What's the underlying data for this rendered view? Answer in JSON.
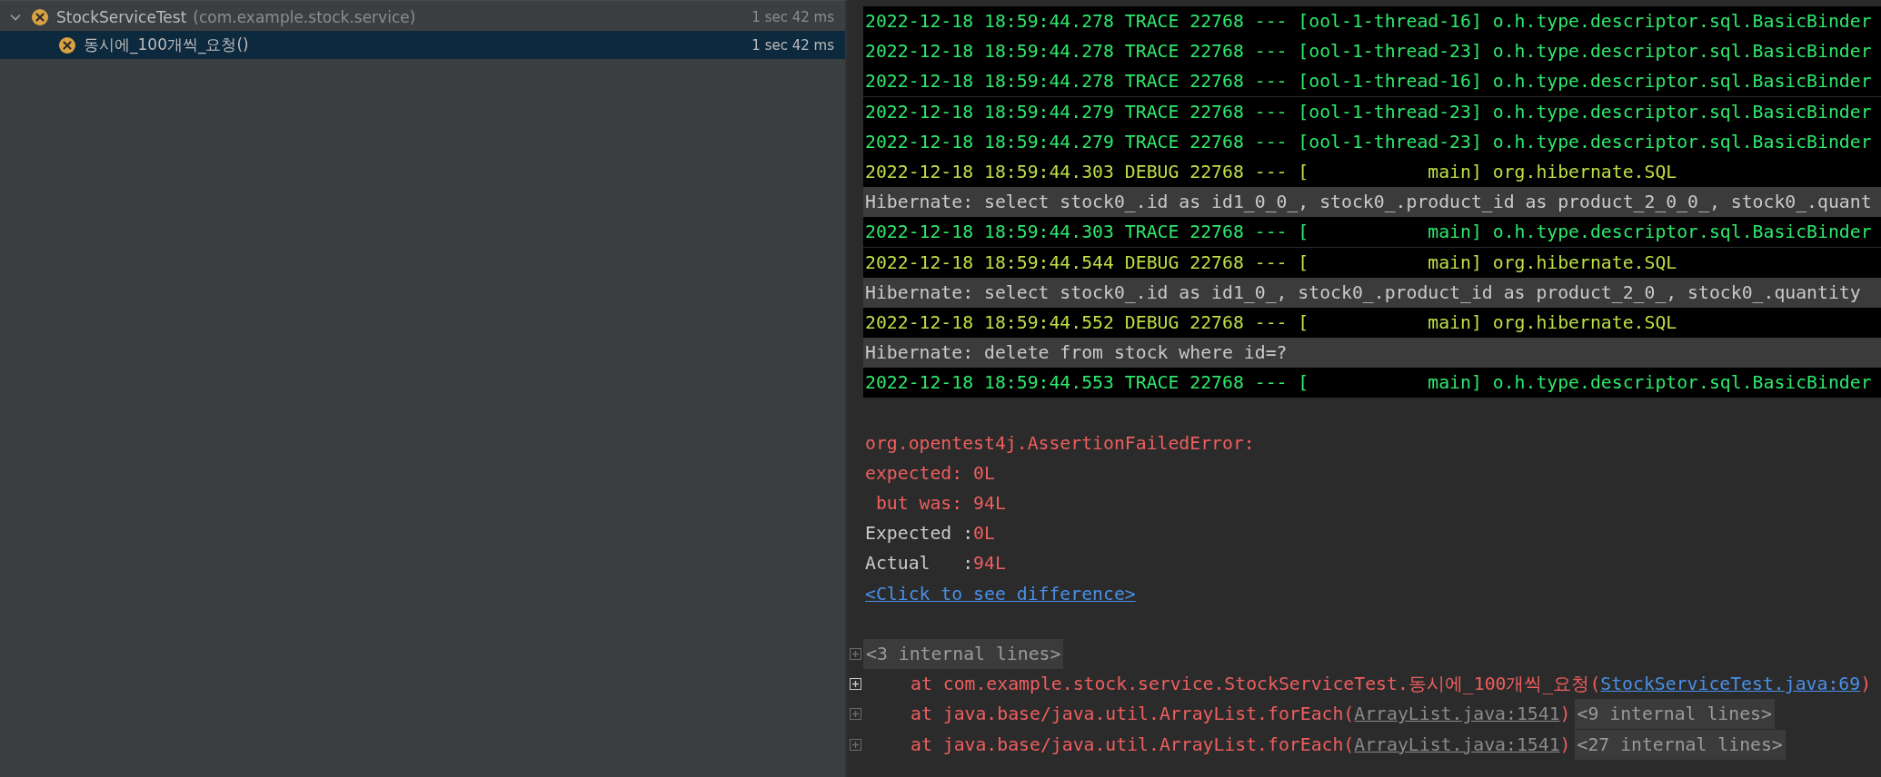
{
  "test_tree": {
    "root": {
      "name": "StockServiceTest",
      "package": "(com.example.stock.service)",
      "time": "1 sec 42 ms",
      "failed": true,
      "expanded": true,
      "selected": false,
      "children": [
        {
          "name": "동시에_100개씩_요청()",
          "time": "1 sec 42 ms",
          "failed": true,
          "selected": true
        }
      ]
    }
  },
  "console": {
    "log_lines": [
      {
        "kind": "trace",
        "text": "2022-12-18 18:59:44.278 TRACE 22768 --- [ool-1-thread-16] o.h.type.descriptor.sql.BasicBinder"
      },
      {
        "kind": "trace",
        "text": "2022-12-18 18:59:44.278 TRACE 22768 --- [ool-1-thread-23] o.h.type.descriptor.sql.BasicBinder"
      },
      {
        "kind": "trace",
        "text": "2022-12-18 18:59:44.278 TRACE 22768 --- [ool-1-thread-16] o.h.type.descriptor.sql.BasicBinder"
      },
      {
        "kind": "trace",
        "text": "2022-12-18 18:59:44.279 TRACE 22768 --- [ool-1-thread-23] o.h.type.descriptor.sql.BasicBinder"
      },
      {
        "kind": "trace",
        "text": "2022-12-18 18:59:44.279 TRACE 22768 --- [ool-1-thread-23] o.h.type.descriptor.sql.BasicBinder"
      },
      {
        "kind": "debug",
        "text": "2022-12-18 18:59:44.303 DEBUG 22768 --- [           main] org.hibernate.SQL"
      },
      {
        "kind": "sql",
        "text": "Hibernate: select stock0_.id as id1_0_0_, stock0_.product_id as product_2_0_0_, stock0_.quant"
      },
      {
        "kind": "trace",
        "text": "2022-12-18 18:59:44.303 TRACE 22768 --- [           main] o.h.type.descriptor.sql.BasicBinder"
      },
      {
        "kind": "debug",
        "text": "2022-12-18 18:59:44.544 DEBUG 22768 --- [           main] org.hibernate.SQL"
      },
      {
        "kind": "sql",
        "text": "Hibernate: select stock0_.id as id1_0_, stock0_.product_id as product_2_0_, stock0_.quantity"
      },
      {
        "kind": "debug",
        "text": "2022-12-18 18:59:44.552 DEBUG 22768 --- [           main] org.hibernate.SQL"
      },
      {
        "kind": "sql",
        "text": "Hibernate: delete from stock where id=?"
      },
      {
        "kind": "trace",
        "text": "2022-12-18 18:59:44.553 TRACE 22768 --- [           main] o.h.type.descriptor.sql.BasicBinder"
      }
    ],
    "assertion": {
      "lines": [
        "org.opentest4j.AssertionFailedError:",
        "expected: 0L",
        " but was: 94L"
      ],
      "comparison": [
        {
          "label": "Expected :",
          "value": "0L"
        },
        {
          "label": "Actual   :",
          "value": "94L"
        }
      ],
      "diff_link": "<Click to see difference>"
    },
    "stack": [
      {
        "kind": "folded",
        "text": "<3 internal lines>",
        "highlighted": false
      },
      {
        "kind": "frame",
        "text": "at com.example.stock.service.StockServiceTest.동시에_100개씩_요청(",
        "link": "StockServiceTest.java:69",
        "link_muted": false,
        "close": ")",
        "highlighted": true
      },
      {
        "kind": "frame",
        "text": "at java.base/java.util.ArrayList.forEach(",
        "link": "ArrayList.java:1541",
        "link_muted": true,
        "close": ")",
        "folded": "<9 internal lines>",
        "highlighted": false
      },
      {
        "kind": "frame",
        "text": "at java.base/java.util.ArrayList.forEach(",
        "link": "ArrayList.java:1541",
        "link_muted": true,
        "close": ")",
        "folded": "<27 internal lines>",
        "highlighted": false
      }
    ]
  }
}
